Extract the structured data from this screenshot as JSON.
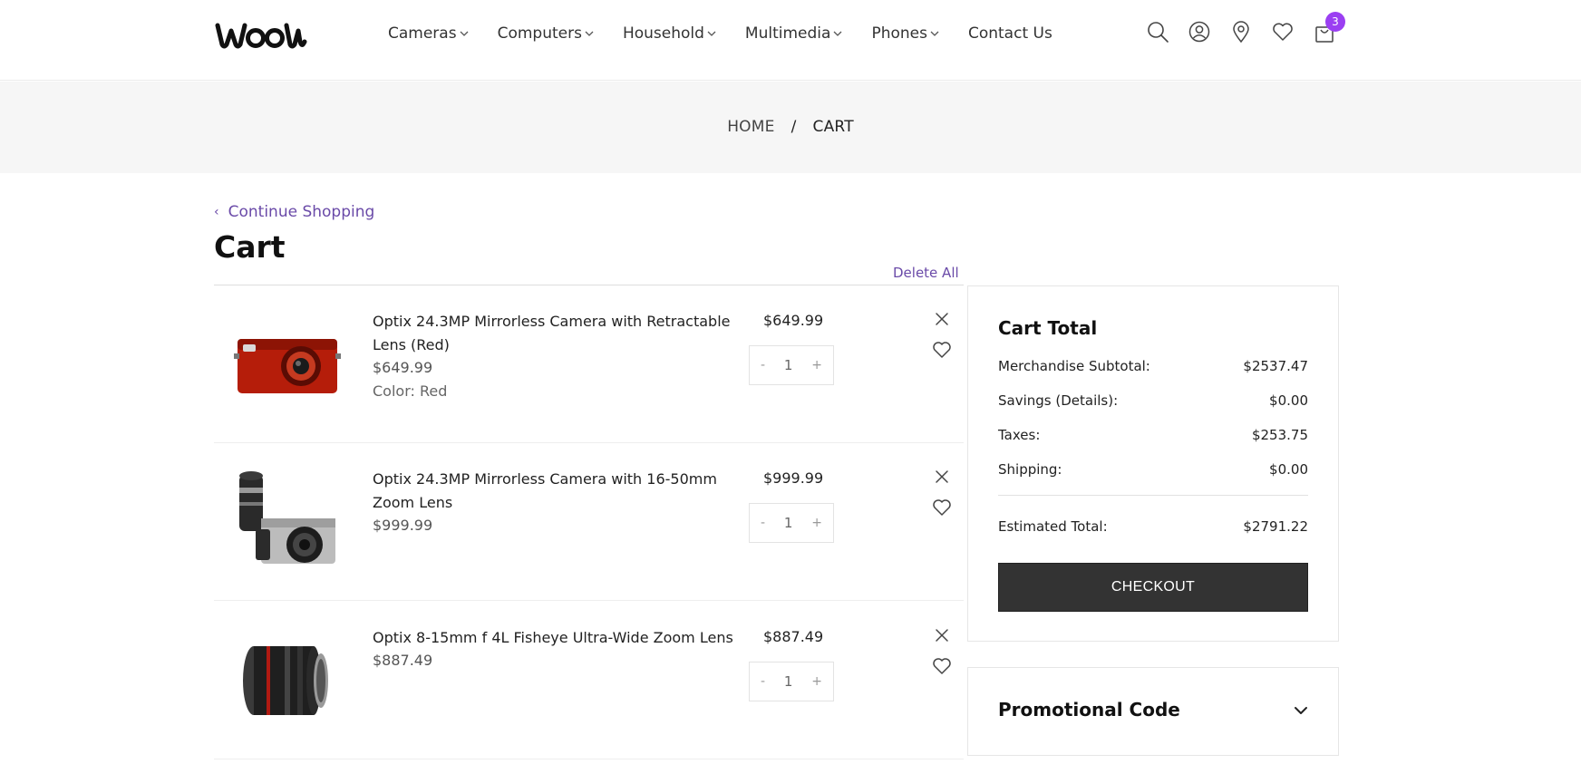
{
  "brand": {
    "logo_text": "woow",
    "accent": "#9b3ff2",
    "link_color": "#6a4aa8"
  },
  "nav": {
    "items": [
      {
        "label": "Cameras",
        "has_dropdown": true
      },
      {
        "label": "Computers",
        "has_dropdown": true
      },
      {
        "label": "Household",
        "has_dropdown": true
      },
      {
        "label": "Multimedia",
        "has_dropdown": true
      },
      {
        "label": "Phones",
        "has_dropdown": true
      },
      {
        "label": "Contact Us",
        "has_dropdown": false
      }
    ]
  },
  "header_icons": {
    "search": "search-icon",
    "account": "user-icon",
    "location": "map-pin-icon",
    "wishlist": "heart-icon",
    "cart": "shopping-bag-icon",
    "cart_count": "3"
  },
  "breadcrumb": {
    "home": "HOME",
    "separator": "/",
    "current": "CART"
  },
  "page": {
    "continue_label": "Continue Shopping",
    "title": "Cart",
    "delete_all": "Delete All"
  },
  "cart_items": [
    {
      "name": "Optix 24.3MP Mirrorless Camera with Retractable Lens (Red)",
      "price": "$649.99",
      "unit_price": "$649.99",
      "color_label": "Color: Red",
      "qty": "1",
      "minus": "-",
      "plus": "+"
    },
    {
      "name": "Optix 24.3MP Mirrorless Camera with 16-50mm Zoom Lens",
      "price": "$999.99",
      "unit_price": "$999.99",
      "color_label": "",
      "qty": "1",
      "minus": "-",
      "plus": "+"
    },
    {
      "name": "Optix 8-15mm f 4L Fisheye Ultra-Wide Zoom Lens",
      "price": "$887.49",
      "unit_price": "$887.49",
      "color_label": "",
      "qty": "1",
      "minus": "-",
      "plus": "+"
    }
  ],
  "cart_total": {
    "title": "Cart Total",
    "rows": [
      {
        "label": "Merchandise Subtotal:",
        "value": "$2537.47"
      },
      {
        "label": "Savings (Details):",
        "value": "$0.00"
      },
      {
        "label": "Taxes:",
        "value": "$253.75"
      },
      {
        "label": "Shipping:",
        "value": "$0.00"
      }
    ],
    "estimated_label": "Estimated Total:",
    "estimated_value": "$2791.22",
    "checkout_label": "CHECKOUT"
  },
  "promo": {
    "title": "Promotional Code"
  }
}
